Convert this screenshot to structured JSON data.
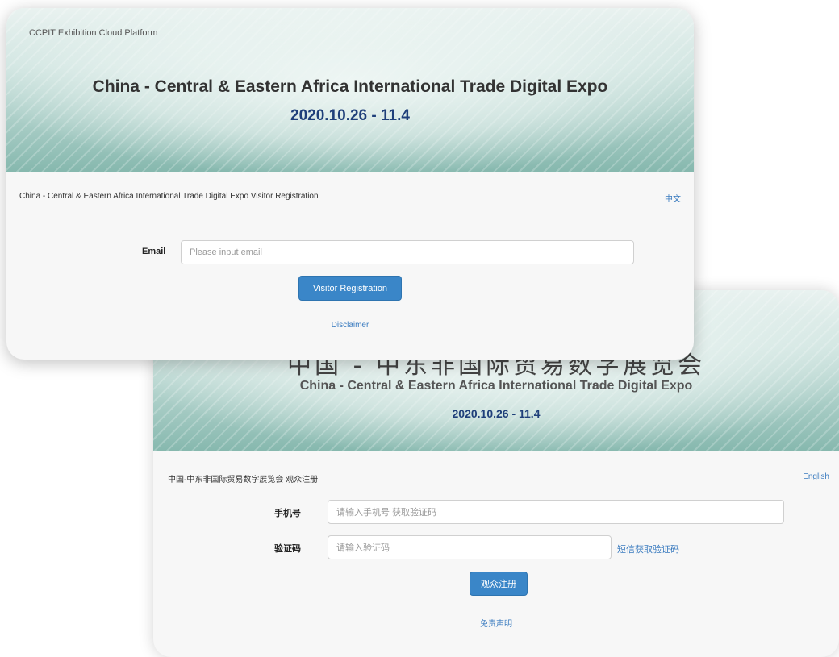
{
  "cn_card": {
    "banner": {
      "title_cn": "中国 - 中东非国际贸易数字展览会",
      "title_en": "China - Central & Eastern Africa International Trade Digital Expo",
      "dates": "2020.10.26 - 11.4"
    },
    "form_title": "中国-中东非国际贸易数字展览会 观众注册",
    "language_link": "English",
    "phone_label": "手机号",
    "phone_placeholder": "请输入手机号 获取验证码",
    "code_label": "验证码",
    "code_placeholder": "请输入验证码",
    "get_code_link": "短信获取验证码",
    "register_button": "观众注册",
    "disclaimer": "免责声明"
  },
  "en_card": {
    "banner": {
      "platform": "CCPIT Exhibition Cloud Platform",
      "title": "China - Central & Eastern Africa International Trade Digital Expo",
      "dates": "2020.10.26 - 11.4"
    },
    "form_title": "China - Central & Eastern Africa International Trade Digital Expo Visitor Registration",
    "language_link": "中文",
    "email_label": "Email",
    "email_placeholder": "Please input email",
    "register_button": "Visitor Registration",
    "disclaimer": "Disclaimer"
  },
  "colors": {
    "banner_teal": "#86b8ae",
    "button_blue": "#3a86c8",
    "title_blue": "#1f3f7a"
  }
}
